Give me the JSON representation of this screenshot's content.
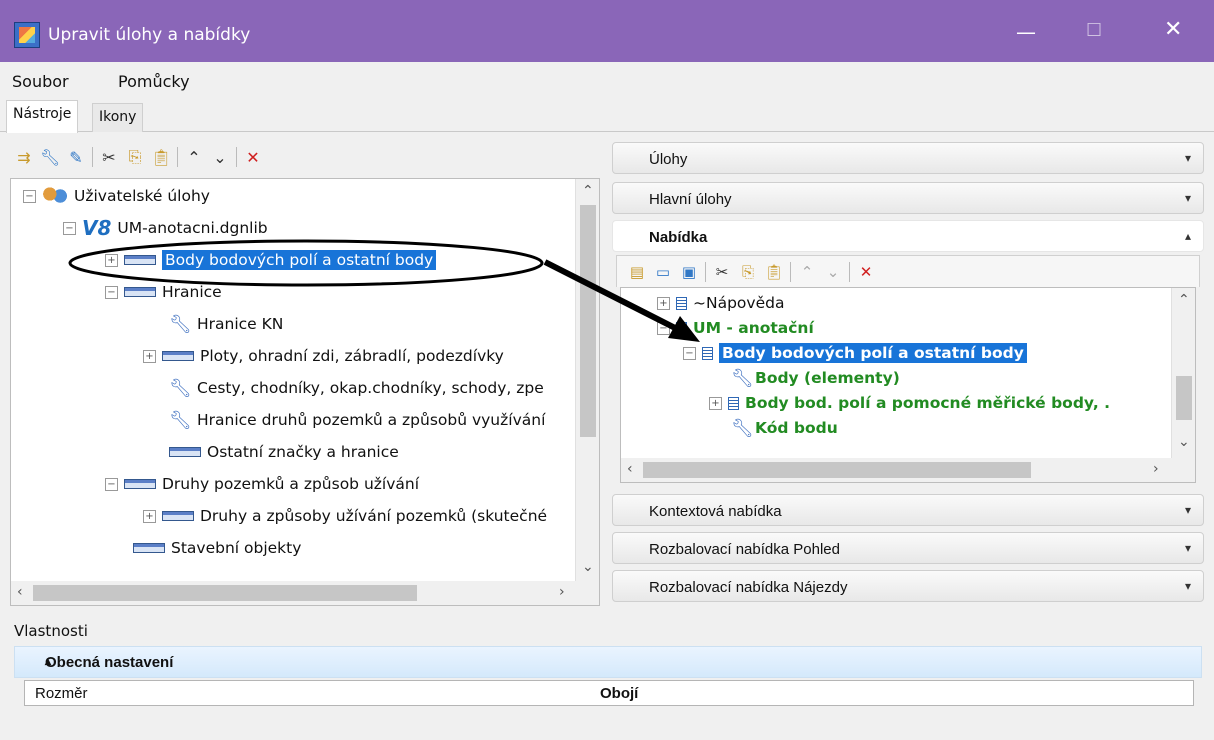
{
  "window": {
    "title": "Upravit úlohy a nabídky"
  },
  "menubar": [
    "Soubor",
    "Pomůcky"
  ],
  "tabs": [
    "Nástroje",
    "Ikony"
  ],
  "left_tree": [
    {
      "label": "Uživatelské úlohy",
      "icon": "users-icon",
      "expander": "−"
    },
    {
      "label": "UM-anotacni.dgnlib",
      "icon": "v8-icon",
      "expander": "−"
    },
    {
      "label": "Body bodových polí a ostatní body",
      "icon": "category-icon",
      "expander": "+",
      "selected": true
    },
    {
      "label": "Hranice",
      "icon": "category-icon",
      "expander": "−"
    },
    {
      "label": "Hranice KN",
      "icon": "wrench-icon"
    },
    {
      "label": "Ploty, ohradní zdi, zábradlí, podezdívky",
      "icon": "category-icon",
      "expander": "+"
    },
    {
      "label": "Cesty, chodníky, okap.chodníky, schody, zpe",
      "icon": "wrench-icon"
    },
    {
      "label": "Hranice druhů pozemků a způsobů využívání",
      "icon": "wrench-icon"
    },
    {
      "label": "Ostatní značky a hranice",
      "icon": "category-icon"
    },
    {
      "label": "Druhy pozemků a způsob užívání",
      "icon": "category-icon",
      "expander": "−"
    },
    {
      "label": "Druhy a způsoby užívání pozemků (skutečné",
      "icon": "category-icon",
      "expander": "+"
    },
    {
      "label": "Stavební objekty",
      "icon": "category-icon"
    }
  ],
  "accordion": {
    "ulohy": "Úlohy",
    "hlavni": "Hlavní úlohy",
    "nabidka": "Nabídka",
    "kontext": "Kontextová nabídka",
    "pohled": "Rozbalovací nabídka Pohled",
    "najezdy": "Rozbalovací nabídka Nájezdy"
  },
  "menu_tree": [
    {
      "label": "~Nápověda",
      "icon": "document-icon",
      "expander": "+"
    },
    {
      "label": "UM - anotační",
      "icon": "document-icon",
      "expander": "−",
      "style": "green"
    },
    {
      "label": "Body bodových polí a ostatní body",
      "icon": "document-icon",
      "expander": "−",
      "selected": true
    },
    {
      "label": "Body (elementy)",
      "icon": "wrench-icon",
      "style": "green"
    },
    {
      "label": "Body bod. polí a pomocné měřické body, .",
      "icon": "document-icon",
      "expander": "+",
      "style": "green"
    },
    {
      "label": "Kód bodu",
      "icon": "wrench-icon",
      "style": "green"
    }
  ],
  "props": {
    "label": "Vlastnosti",
    "section": "Obecná nastavení",
    "row_key": "Rozměr",
    "row_value": "Obojí"
  },
  "colors": {
    "titlebar": "#8a66b8",
    "selection": "#1874d8",
    "green_text": "#228b22"
  }
}
